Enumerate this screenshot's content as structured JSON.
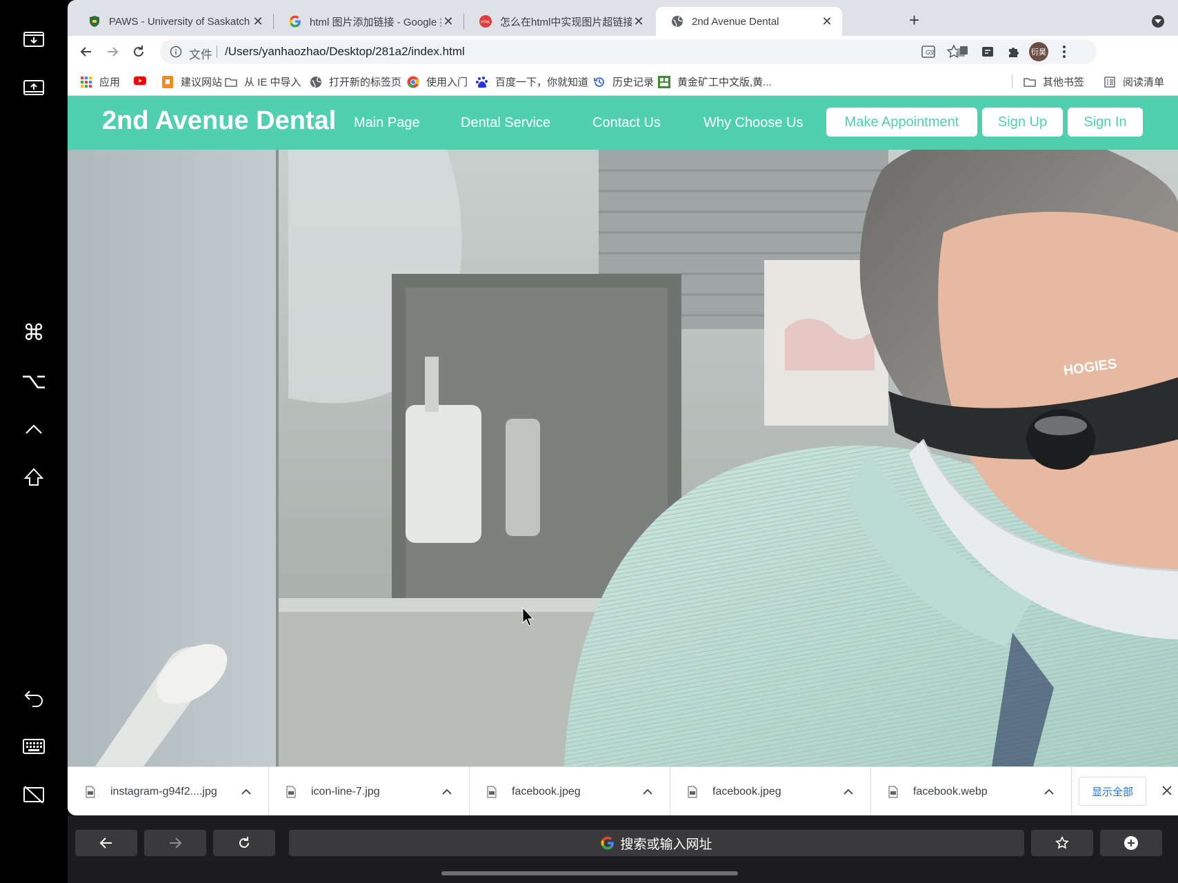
{
  "tabs": [
    {
      "title": "PAWS - University of Saskatch",
      "icon": "shield-icon"
    },
    {
      "title": "html 图片添加链接 - Google 搜索",
      "icon": "google-icon"
    },
    {
      "title": "怎么在html中实现图片超链接?",
      "icon": "html-icon"
    },
    {
      "title": "2nd Avenue Dental",
      "icon": "globe-icon",
      "active": true
    }
  ],
  "address": {
    "scheme": "文件",
    "url": "/Users/yanhaozhao/Desktop/281a2/index.html"
  },
  "profile_initials": "衍昊",
  "bookmarks": [
    {
      "label": "应用",
      "icon": "apps-grid-icon"
    },
    {
      "label": "",
      "icon": "youtube-icon"
    },
    {
      "label": "建议网站",
      "icon": "suggested-sites-icon"
    },
    {
      "label": "从 IE 中导入",
      "icon": "folder-icon"
    },
    {
      "label": "打开新的标签页",
      "icon": "globe-icon"
    },
    {
      "label": "使用入门",
      "icon": "chrome-icon"
    },
    {
      "label": "百度一下，你就知道",
      "icon": "baidu-icon"
    },
    {
      "label": "历史记录",
      "icon": "history-icon"
    },
    {
      "label": "黄金矿工中文版,黄...",
      "icon": "game-icon"
    }
  ],
  "bookmarks_right": [
    {
      "label": "其他书签",
      "icon": "folder-icon"
    },
    {
      "label": "阅读清单",
      "icon": "reading-list-icon"
    }
  ],
  "site": {
    "brand": "2nd Avenue Dental",
    "nav_links": [
      "Main Page",
      "Dental Service",
      "Contact Us",
      "Why Choose Us"
    ],
    "nav_buttons": [
      "Make Appointment",
      "Sign Up",
      "Sign In"
    ],
    "accent": "#50cfb1",
    "hero_goggles_text": "HOGIES"
  },
  "downloads": [
    {
      "name": "instagram-g94f2....jpg"
    },
    {
      "name": "icon-line-7.jpg"
    },
    {
      "name": "facebook.jpeg"
    },
    {
      "name": "facebook.jpeg"
    },
    {
      "name": "facebook.webp"
    }
  ],
  "downloads_show_all": "显示全部",
  "bottom_bar": {
    "search_placeholder": "搜索或输入网址"
  },
  "sidebar_icons": [
    "tray-download-icon",
    "tray-upload-icon",
    "command-key-icon",
    "option-key-icon",
    "control-key-icon",
    "shift-key-icon",
    "undo-icon",
    "keyboard-icon",
    "display-off-icon"
  ]
}
